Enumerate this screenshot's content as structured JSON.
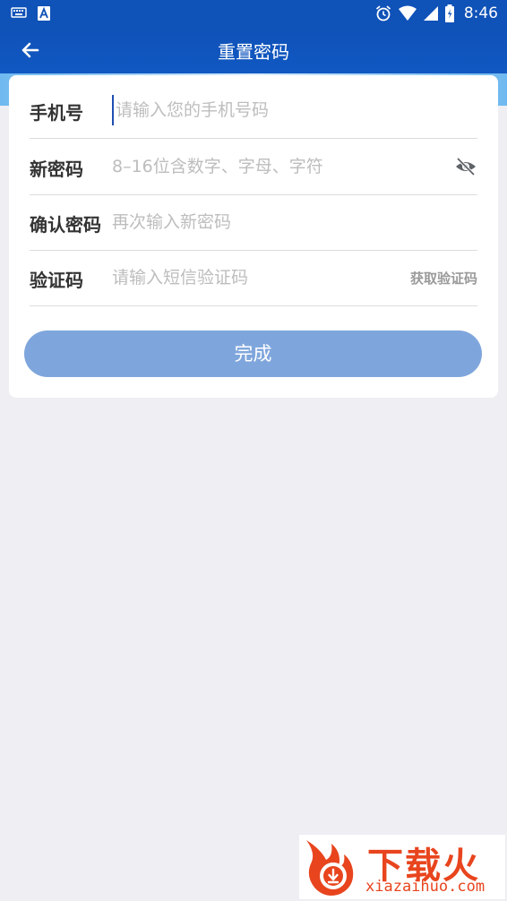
{
  "status_bar": {
    "time": "8:46",
    "left_icons": [
      "keyboard-icon",
      "app-a-icon"
    ],
    "right_icons": [
      "alarm-icon",
      "wifi-icon",
      "signal-icon",
      "battery-icon"
    ]
  },
  "header": {
    "title": "重置密码",
    "back_icon": "arrow-left-icon"
  },
  "form": {
    "phone": {
      "label": "手机号",
      "placeholder": "请输入您的手机号码",
      "value": ""
    },
    "new_password": {
      "label": "新密码",
      "placeholder": "8–16位含数字、字母、字符",
      "value": "",
      "toggle_icon": "eye-off-icon"
    },
    "confirm_password": {
      "label": "确认密码",
      "placeholder": "再次输入新密码",
      "value": ""
    },
    "verification_code": {
      "label": "验证码",
      "placeholder": "请输入短信验证码",
      "value": "",
      "get_code_label": "获取验证码"
    },
    "submit_label": "完成"
  },
  "watermark": {
    "brand": "下载火",
    "domain": "xiazaihuo.com"
  },
  "colors": {
    "header": "#0f52b8",
    "submit_button": "#7fa6dc",
    "page_background": "#eeeef3",
    "watermark": "#e8451e"
  }
}
